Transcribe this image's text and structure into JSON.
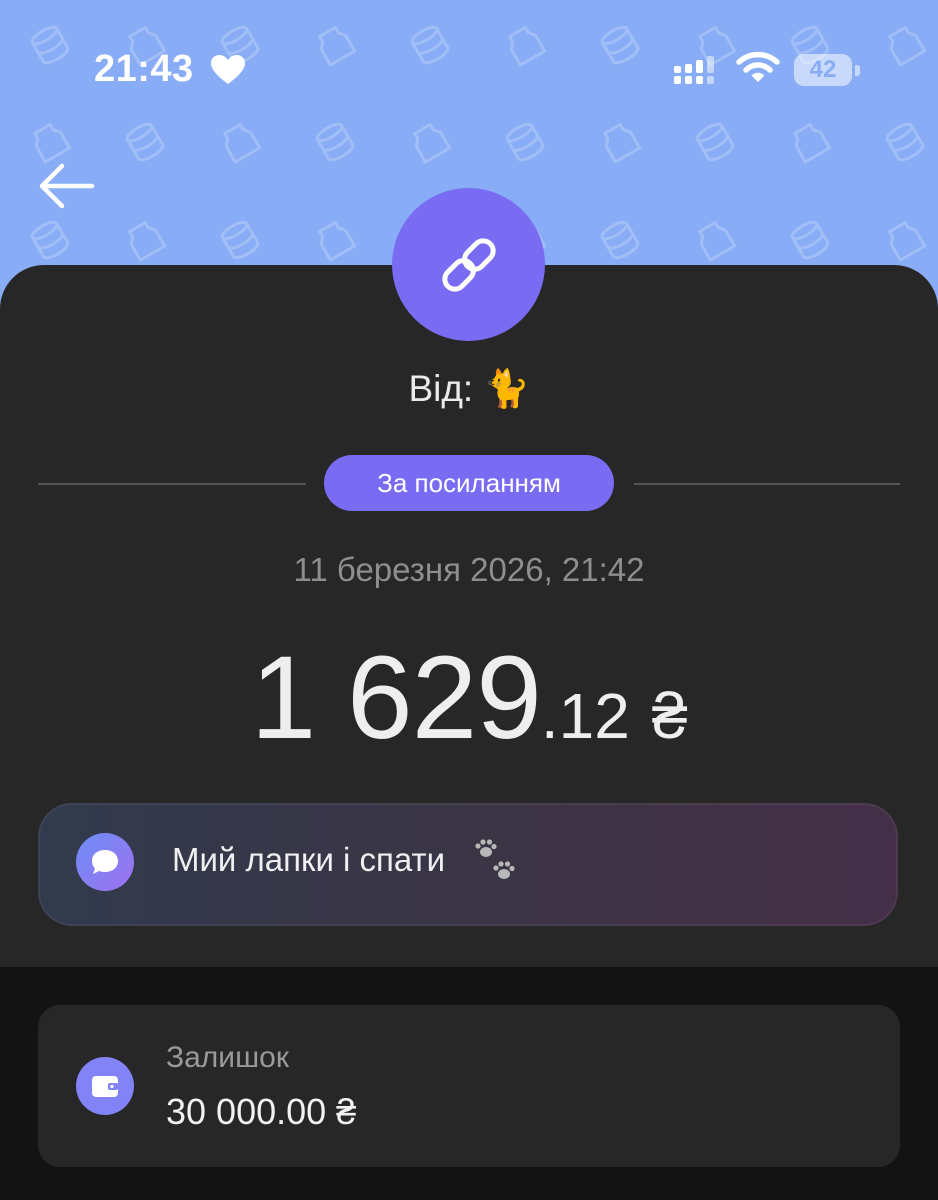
{
  "status_bar": {
    "time": "21:43",
    "battery": "42"
  },
  "transaction": {
    "from_label": "Від: 🐈",
    "method_badge": "За посиланням",
    "datetime": "11 березня 2026, 21:42",
    "amount_integer": "1 629",
    "amount_fraction": ".12",
    "currency": "₴",
    "comment": "Мий лапки і спати"
  },
  "balance": {
    "label": "Залишок",
    "value": "30 000.00 ₴"
  },
  "colors": {
    "header_bg": "#88acf5",
    "accent": "#7a6cf2",
    "card_bg": "#272727",
    "page_bg": "#131313"
  },
  "icons": {
    "back": "arrow-left-icon",
    "avatar": "link-icon",
    "comment": "chat-bubble-icon",
    "balance": "wallet-icon",
    "status": [
      "heart-icon",
      "signal-icon",
      "wifi-icon",
      "battery-icon"
    ]
  }
}
